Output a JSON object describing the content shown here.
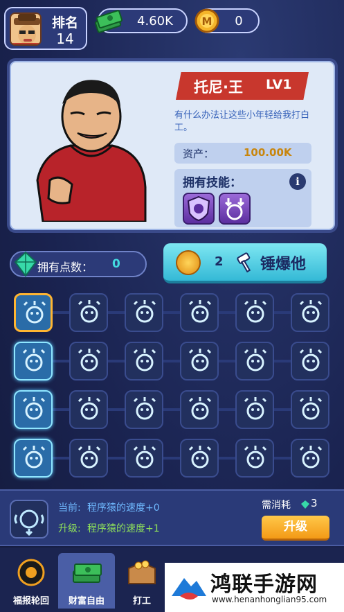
{
  "header": {
    "rank_label": "排名",
    "rank_value": "14",
    "cash": "4.60K",
    "coins": "0"
  },
  "profile": {
    "name": "托尼·王",
    "level": "LV1",
    "description": "有什么办法让这些小年轻给我打白工。",
    "asset_label": "资产：",
    "asset_value": "100.00K",
    "skills_label": "拥有技能："
  },
  "points": {
    "label": "拥有点数：",
    "value": "0"
  },
  "smash": {
    "count": "2",
    "label": "锤爆他"
  },
  "upgrade_panel": {
    "current_label": "当前:",
    "current_value": "程序猿的速度+0",
    "upgrade_label": "升级:",
    "upgrade_value": "程序猿的速度+1",
    "cost_label": "需消耗",
    "cost_value": "3",
    "button_label": "升级"
  },
  "nav": {
    "items": [
      {
        "label": "福报轮回",
        "icon": "wheel-icon"
      },
      {
        "label": "财富自由",
        "icon": "money-stack-icon"
      },
      {
        "label": "打工",
        "icon": "box-icon"
      }
    ]
  },
  "watermark": {
    "title": "鸿联手游网",
    "url": "www.henanhonglian95.com"
  },
  "colors": {
    "accent_cyan": "#43d9e0",
    "gold": "#c8860e",
    "banner_red": "#c8372d",
    "current_blue": "#6fb9ff",
    "upgrade_green": "#8ee05a"
  }
}
